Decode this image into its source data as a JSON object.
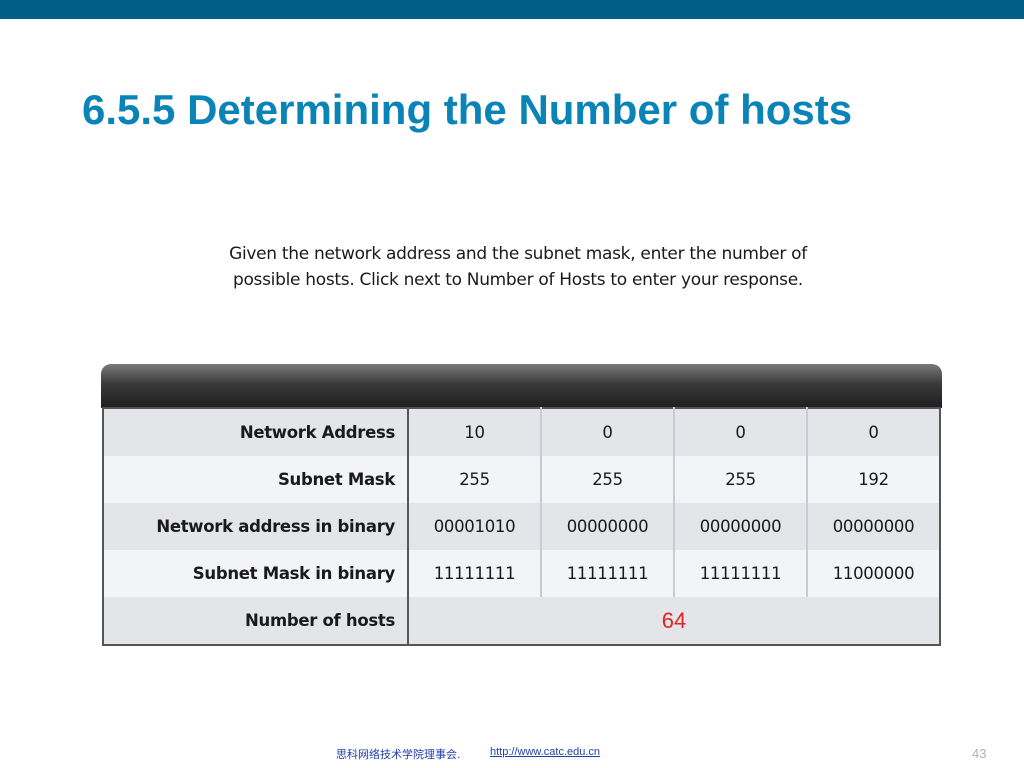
{
  "slide": {
    "title": "6.5.5 Determining the Number of hosts",
    "instructions": "Given the network address and the subnet mask, enter the number of possible hosts. Click next to Number of Hosts to enter your response.",
    "page_number": "43"
  },
  "table": {
    "rows": [
      {
        "label": "Network Address",
        "octets": [
          "10",
          "0",
          "0",
          "0"
        ]
      },
      {
        "label": "Subnet Mask",
        "octets": [
          "255",
          "255",
          "255",
          "192"
        ]
      },
      {
        "label": "Network address in binary",
        "octets": [
          "00001010",
          "00000000",
          "00000000",
          "00000000"
        ]
      },
      {
        "label": "Subnet Mask in binary",
        "octets": [
          "11111111",
          "11111111",
          "11111111",
          "11000000"
        ]
      }
    ],
    "hosts_label": "Number of hosts",
    "hosts_value": "64"
  },
  "footer": {
    "org": "思科网络技术学院理事会.",
    "link": "http://www.catc.edu.cn"
  },
  "colors": {
    "top_bar": "#005f87",
    "title": "#0a83b7",
    "hosts_value": "#e02424",
    "footer_text": "#1f3fa8"
  }
}
